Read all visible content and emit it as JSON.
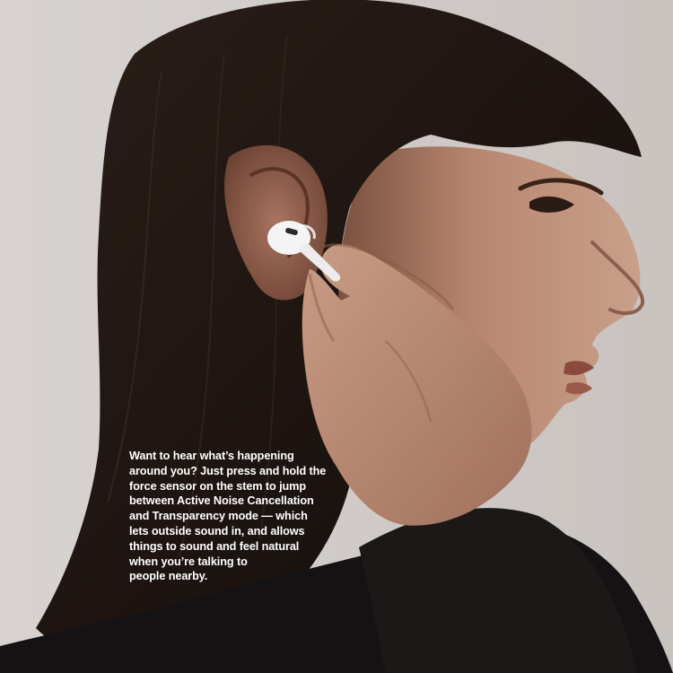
{
  "caption": {
    "lines": [
      "Want to hear what’s happening",
      "around you? Just press and hold the",
      "force sensor on the stem to jump",
      "between Active Noise Cancellation",
      "and Transparency mode — which",
      "lets outside sound in, and allows",
      "things to sound and feel natural",
      "when you’re talking to",
      "people nearby."
    ]
  },
  "colors": {
    "background": "#d3cecb",
    "hair": "#1c1410",
    "skin": "#c79a82",
    "skin_shadow": "#8c5f4c",
    "earbud": "#f4f4f4",
    "sweater": "#141212",
    "caption_text": "#ffffff"
  },
  "icons": {
    "earbud": "airpods-pro-earbud"
  }
}
